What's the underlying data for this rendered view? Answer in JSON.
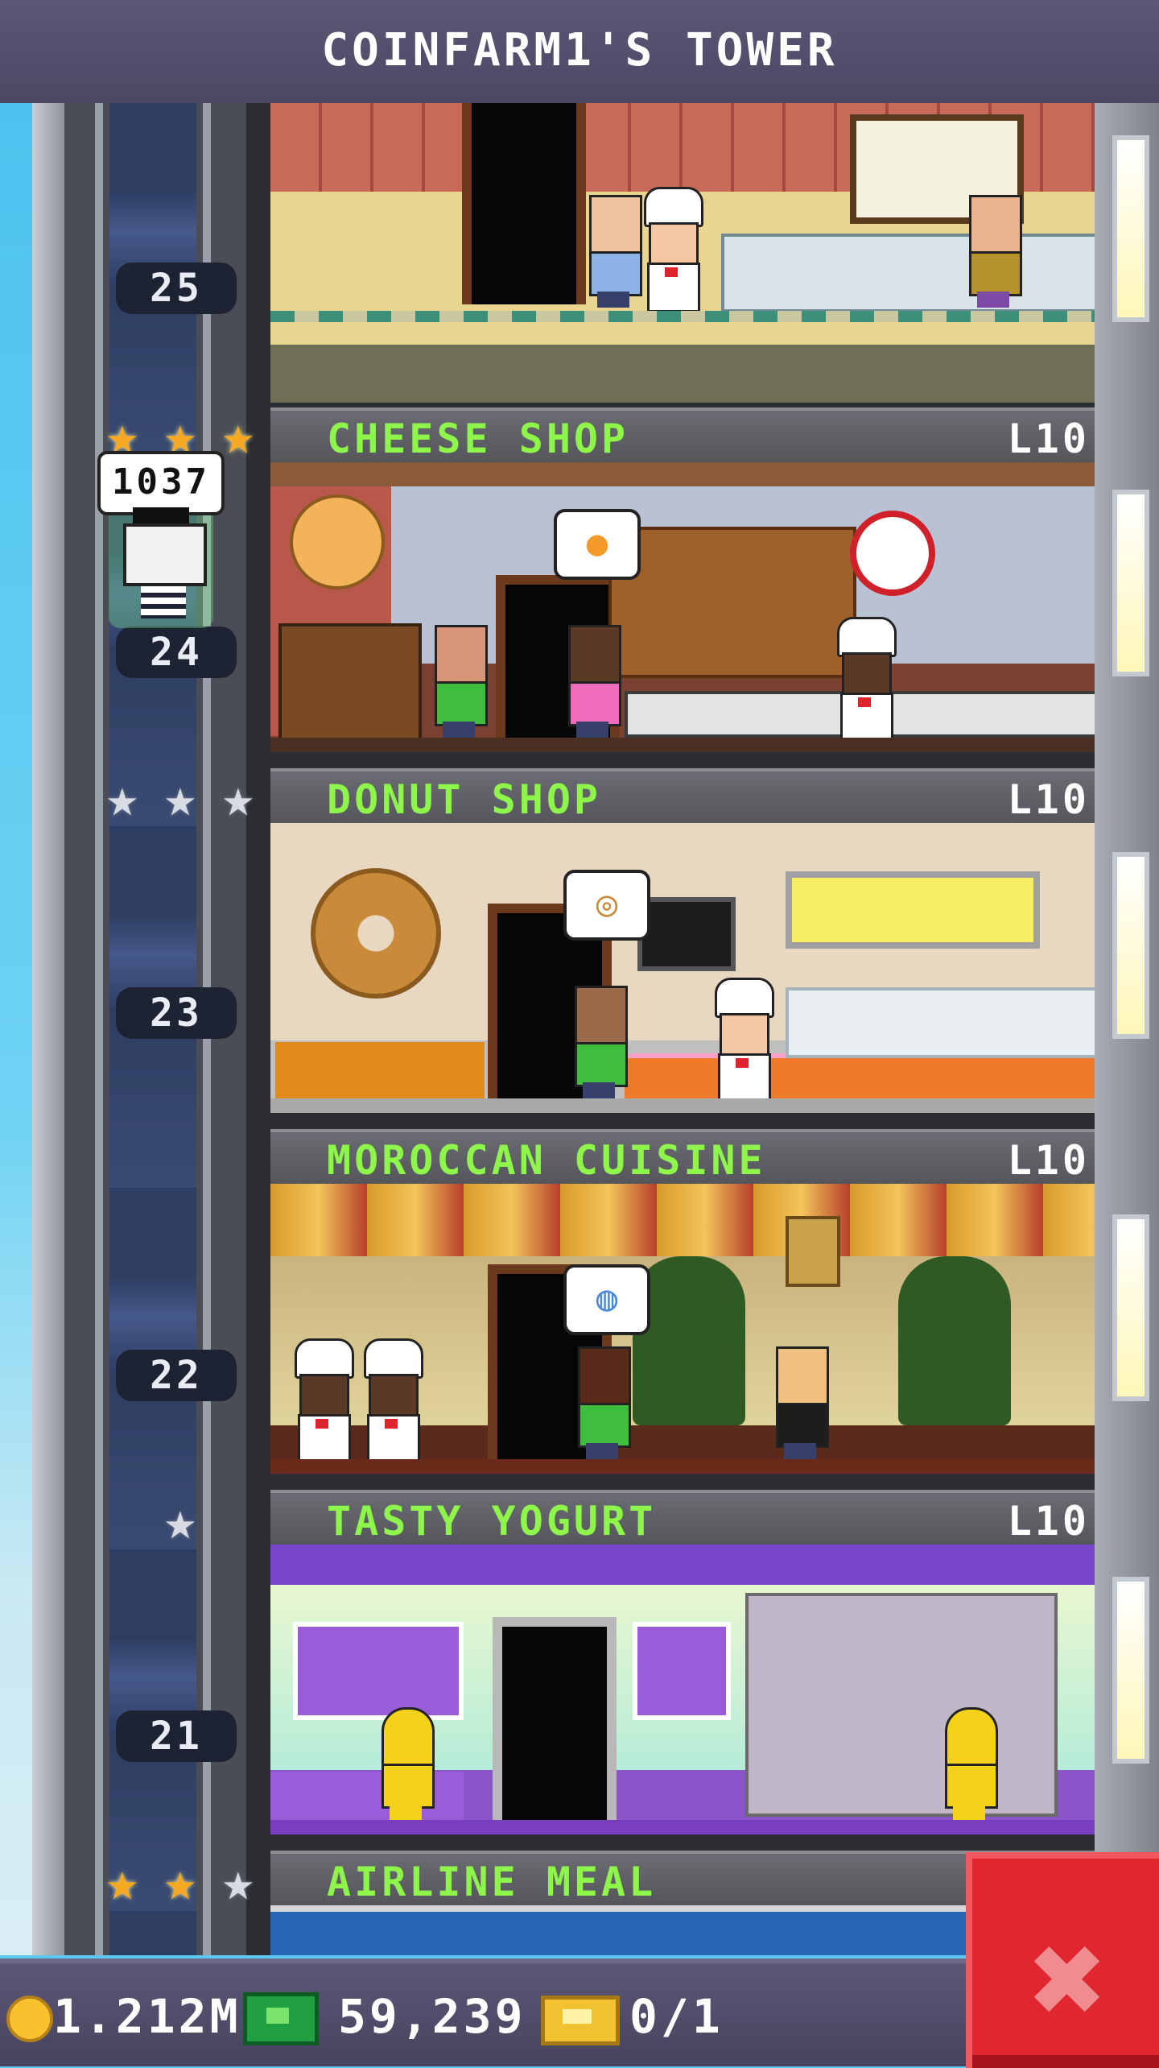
{
  "header": {
    "title": "COINFARM1'S TOWER"
  },
  "elevator": {
    "rider_count": "1037"
  },
  "floors": [
    {
      "number": "25",
      "name": "CHEESE SHOP",
      "level": "L10",
      "stars": [
        "gold",
        "gold",
        "gold"
      ]
    },
    {
      "number": "24",
      "name": "DONUT SHOP",
      "level": "L10",
      "stars": [
        "silver",
        "silver",
        "silver"
      ]
    },
    {
      "number": "23",
      "name": "MOROCCAN CUISINE",
      "level": "L10",
      "stars": []
    },
    {
      "number": "22",
      "name": "TASTY YOGURT",
      "level": "L10",
      "stars": [
        "silver"
      ]
    },
    {
      "number": "21",
      "name": "AIRLINE MEAL",
      "level": "",
      "stars": [
        "gold",
        "gold",
        "silver"
      ]
    }
  ],
  "status_bar": {
    "coins": "1.212M",
    "tower_bux": "59,239",
    "tickets": "0/1"
  },
  "icons": {
    "star": "★",
    "close": "✖",
    "coin": "coin-icon",
    "bux": "tower-bux-icon",
    "ticket": "golden-ticket-icon"
  },
  "colors": {
    "label_text": "#8ef54a",
    "gold_star": "#f7a823",
    "silver_star": "#d7dbe4",
    "close_button": "#e0262e"
  }
}
